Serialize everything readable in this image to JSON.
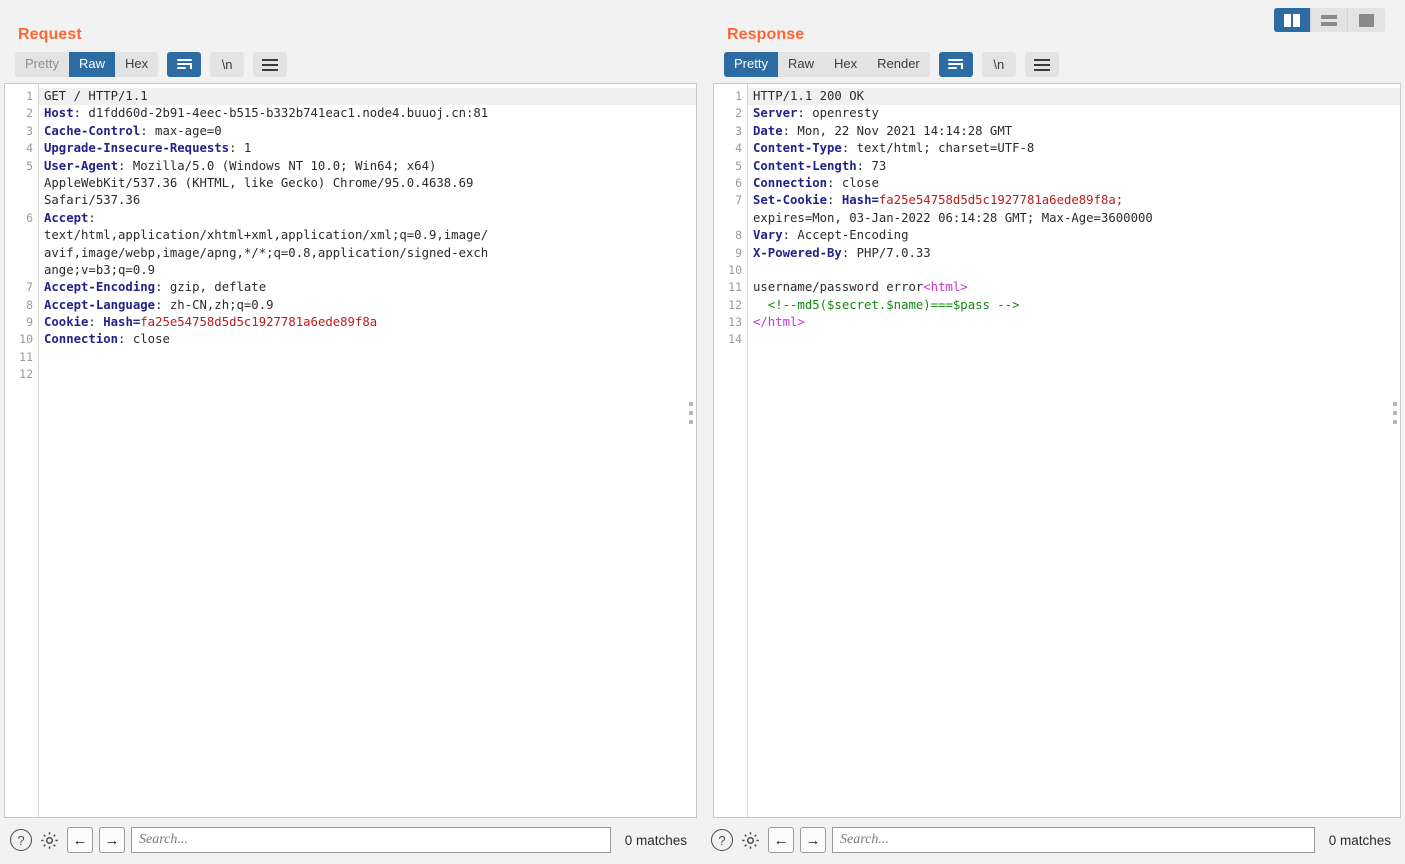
{
  "window": {
    "layout_buttons": [
      {
        "name": "side-by-side",
        "label": "",
        "active": true
      },
      {
        "name": "stacked",
        "label": "",
        "active": false
      },
      {
        "name": "single-pane",
        "label": "",
        "active": false
      }
    ]
  },
  "request": {
    "title": "Request",
    "tabs": [
      "Pretty",
      "Raw",
      "Hex"
    ],
    "active_tab": "Raw",
    "wrap_label": "wrap-lines-icon",
    "newline_label": "\\n",
    "menu_label": "menu-icon",
    "line_numbers": [
      "1",
      "2",
      "3",
      "4",
      "5",
      "",
      "",
      "6",
      "",
      "",
      "",
      "7",
      "8",
      "9",
      "10",
      "11",
      "12"
    ],
    "lines": [
      {
        "text": "GET / HTTP/1.1",
        "type": "plain",
        "first": true
      },
      {
        "name": "Host",
        "value": "d1fdd60d-2b91-4eec-b515-b332b741eac1.node4.buuoj.cn:81",
        "type": "header"
      },
      {
        "name": "Cache-Control",
        "value": "max-age=0",
        "type": "header"
      },
      {
        "name": "Upgrade-Insecure-Requests",
        "value": "1",
        "type": "header"
      },
      {
        "name": "User-Agent",
        "value": "Mozilla/5.0 (Windows NT 10.0; Win64; x64)",
        "type": "header"
      },
      {
        "text": "AppleWebKit/537.36 (KHTML, like Gecko) Chrome/95.0.4638.69",
        "type": "cont"
      },
      {
        "text": "Safari/537.36",
        "type": "cont"
      },
      {
        "name": "Accept",
        "value": "",
        "type": "header"
      },
      {
        "text": "text/html,application/xhtml+xml,application/xml;q=0.9,image/",
        "type": "cont"
      },
      {
        "text": "avif,image/webp,image/apng,*/*;q=0.8,application/signed-exch",
        "type": "cont"
      },
      {
        "text": "ange;v=b3;q=0.9",
        "type": "cont"
      },
      {
        "name": "Accept-Encoding",
        "value": "gzip, deflate",
        "type": "header"
      },
      {
        "name": "Accept-Language",
        "value": "zh-CN,zh;q=0.9",
        "type": "header"
      },
      {
        "name": "Cookie",
        "value": "Hash=",
        "red": "fa25e54758d5d5c1927781a6ede89f8a",
        "type": "cookie"
      },
      {
        "name": "Connection",
        "value": "close",
        "type": "header"
      },
      {
        "text": "",
        "type": "plain"
      },
      {
        "text": "",
        "type": "plain"
      }
    ],
    "search_placeholder": "Search...",
    "matches": "0 matches",
    "help_icon": "?",
    "gear_icon": "gear-icon",
    "prev_icon": "←",
    "next_icon": "→"
  },
  "response": {
    "title": "Response",
    "tabs": [
      "Pretty",
      "Raw",
      "Hex",
      "Render"
    ],
    "active_tab": "Pretty",
    "newline_label": "\\n",
    "line_numbers": [
      "1",
      "2",
      "3",
      "4",
      "5",
      "6",
      "7",
      "",
      "8",
      "9",
      "10",
      "11",
      "12",
      "13",
      "14"
    ],
    "lines": [
      {
        "text": "HTTP/1.1 200 OK",
        "type": "plain",
        "first": true
      },
      {
        "name": "Server",
        "value": "openresty",
        "type": "header"
      },
      {
        "name": "Date",
        "value": "Mon, 22 Nov 2021 14:14:28 GMT",
        "type": "header"
      },
      {
        "name": "Content-Type",
        "value": "text/html; charset=UTF-8",
        "type": "header"
      },
      {
        "name": "Content-Length",
        "value": "73",
        "type": "header"
      },
      {
        "name": "Connection",
        "value": "close",
        "type": "header"
      },
      {
        "name": "Set-Cookie",
        "value": "Hash=",
        "red": "fa25e54758d5d5c1927781a6ede89f8a;",
        "type": "cookie"
      },
      {
        "text": "expires=Mon, 03-Jan-2022 06:14:28 GMT; Max-Age=3600000",
        "type": "cont"
      },
      {
        "name": "Vary",
        "value": "Accept-Encoding",
        "type": "header"
      },
      {
        "name": "X-Powered-By",
        "value": "PHP/7.0.33",
        "type": "header"
      },
      {
        "text": "",
        "type": "plain"
      },
      {
        "text": "username/password error",
        "tag": "<html>",
        "type": "body-tag"
      },
      {
        "comment": "  <!--md5($secret.$name)===$pass -->",
        "type": "body-comment"
      },
      {
        "tag": "</html>",
        "type": "body-tagonly"
      },
      {
        "text": "",
        "type": "plain"
      }
    ],
    "search_placeholder": "Search...",
    "matches": "0 matches",
    "help_icon": "?",
    "gear_icon": "gear-icon",
    "prev_icon": "←",
    "next_icon": "→"
  },
  "colors": {
    "accent_orange": "#ff6633",
    "accent_blue": "#2d6ca2",
    "header_name": "#22228c",
    "cookie_red": "#b81c1c",
    "tag_magenta": "#cc33cc",
    "comment_green": "#118811"
  }
}
